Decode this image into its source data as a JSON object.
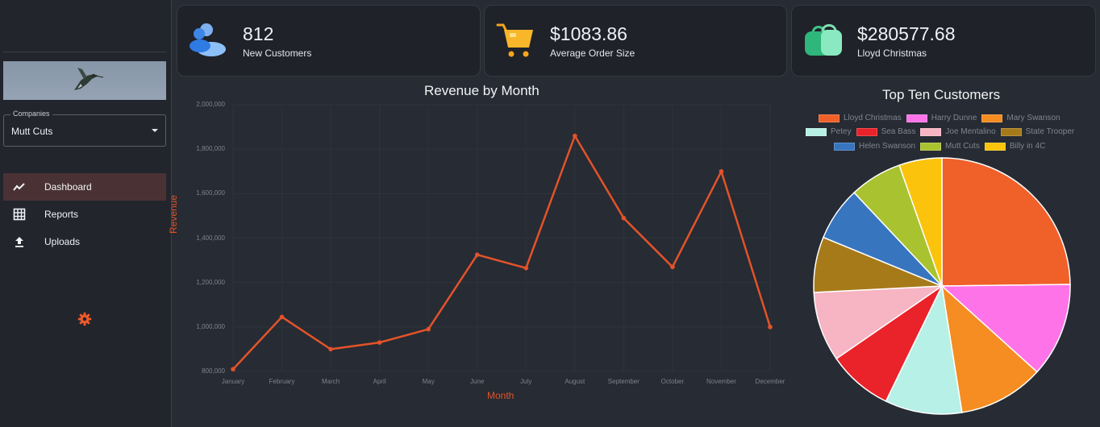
{
  "sidebar": {
    "companies_label": "Companies",
    "company_selected": "Mutt Cuts",
    "nav": [
      {
        "label": "Dashboard",
        "icon": "trend-line-icon",
        "active": true
      },
      {
        "label": "Reports",
        "icon": "table-grid-icon",
        "active": false
      },
      {
        "label": "Uploads",
        "icon": "upload-icon",
        "active": false
      }
    ]
  },
  "cards": [
    {
      "value": "812",
      "label": "New Customers",
      "icon": "users-icon"
    },
    {
      "value": "$1083.86",
      "label": "Average Order Size",
      "icon": "shopping-cart-icon"
    },
    {
      "value": "$280577.68",
      "label": "Lloyd Christmas",
      "icon": "shopping-bag-icon"
    }
  ],
  "colors": {
    "accent": "#ef5a2b",
    "line": "#e2532a"
  },
  "chart_data": [
    {
      "type": "line",
      "title": "Revenue by Month",
      "xlabel": "Month",
      "ylabel": "Revenue",
      "categories": [
        "January",
        "February",
        "March",
        "April",
        "May",
        "June",
        "July",
        "August",
        "September",
        "October",
        "November",
        "December"
      ],
      "values": [
        810000,
        1045000,
        900000,
        930000,
        990000,
        1325000,
        1265000,
        1860000,
        1490000,
        1270000,
        1700000,
        1000000
      ],
      "ylim": [
        800000,
        2000000
      ],
      "yticks": [
        "2,000,000",
        "1,800,000",
        "1,600,000",
        "1,400,000",
        "1,200,000",
        "1,000,000",
        "800,000"
      ],
      "grid": true
    },
    {
      "type": "pie",
      "title": "Top Ten Customers",
      "legend": "top",
      "slices": [
        {
          "name": "Lloyd Christmas",
          "value": 24.8,
          "color": "#f06029"
        },
        {
          "name": "Harry Dunne",
          "value": 11.9,
          "color": "#ff73e8"
        },
        {
          "name": "Mary Swanson",
          "value": 10.8,
          "color": "#f58d22"
        },
        {
          "name": "Petey",
          "value": 9.7,
          "color": "#b6f0e6"
        },
        {
          "name": "Sea Bass",
          "value": 8.2,
          "color": "#ea2229"
        },
        {
          "name": "Joe Mentalino",
          "value": 8.8,
          "color": "#f7b4c3"
        },
        {
          "name": "State Trooper",
          "value": 7.0,
          "color": "#a77a19"
        },
        {
          "name": "Helen Swanson",
          "value": 6.8,
          "color": "#3775bf"
        },
        {
          "name": "Mutt Cuts",
          "value": 6.6,
          "color": "#a9c22f"
        },
        {
          "name": "Billy in 4C",
          "value": 5.4,
          "color": "#fbc30b"
        }
      ]
    }
  ]
}
